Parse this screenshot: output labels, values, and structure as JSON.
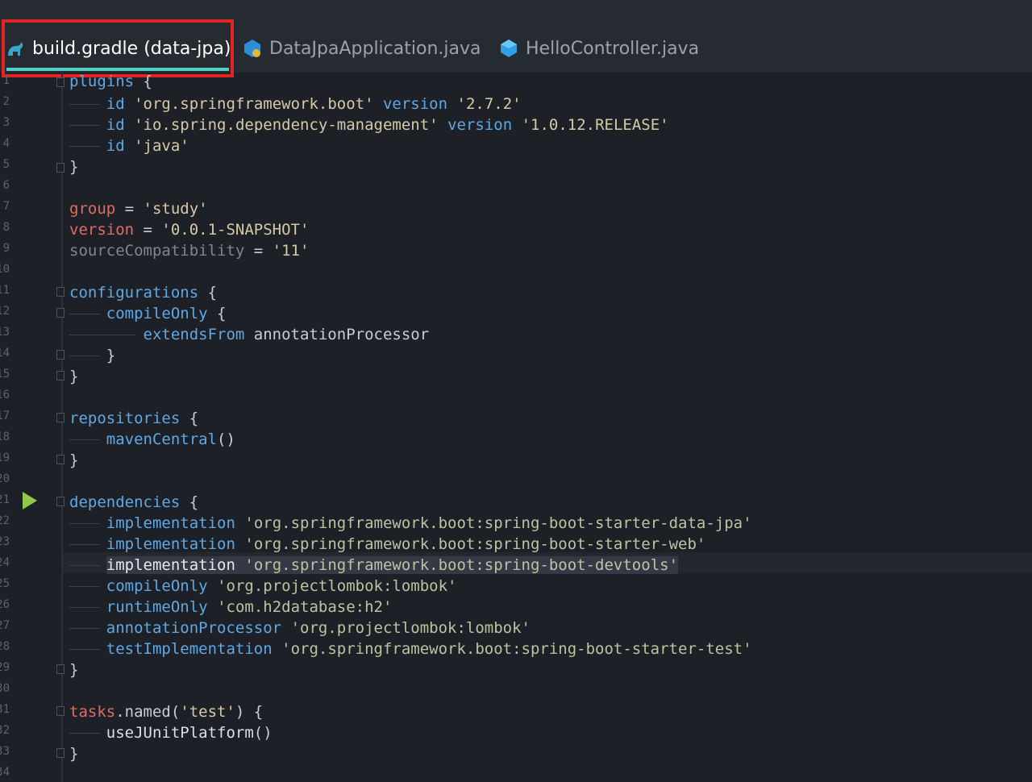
{
  "tabs": [
    {
      "label": "build.gradle (data-jpa)",
      "icon": "gradle-icon",
      "active": true
    },
    {
      "label": "DataJpaApplication.java",
      "icon": "java-class-run-icon",
      "active": false
    },
    {
      "label": "HelloController.java",
      "icon": "java-class-icon",
      "active": false
    }
  ],
  "line_numbers": [
    "1",
    "2",
    "3",
    "4",
    "5",
    "6",
    "7",
    "8",
    "9",
    "10",
    "11",
    "12",
    "13",
    "14",
    "15",
    "16",
    "17",
    "18",
    "19",
    "20",
    "21",
    "22",
    "23",
    "24",
    "25",
    "26",
    "27",
    "28",
    "29",
    "30",
    "31",
    "32",
    "33",
    "34"
  ],
  "code": {
    "l1": {
      "kw": "plugins",
      "rest": " {"
    },
    "l2": {
      "kw": "id",
      "str": "'org.springframework.boot'",
      "kw2": "version",
      "str2": "'2.7.2'"
    },
    "l3": {
      "kw": "id",
      "str": "'io.spring.dependency-management'",
      "kw2": "version",
      "str2": "'1.0.12.RELEASE'"
    },
    "l4": {
      "kw": "id",
      "str": "'java'"
    },
    "l5": "}",
    "l7": {
      "kw": "group",
      "op": " = ",
      "str": "'study'"
    },
    "l8": {
      "kw": "version",
      "op": " = ",
      "str": "'0.0.1-SNAPSHOT'"
    },
    "l9": {
      "kw": "sourceCompatibility",
      "op": " = ",
      "str": "'11'"
    },
    "l11": {
      "kw": "configurations",
      "rest": " {"
    },
    "l12": {
      "kw": "compileOnly",
      "rest": " {"
    },
    "l13": {
      "kw": "extendsFrom",
      "rest": " annotationProcessor"
    },
    "l14": "}",
    "l15": "}",
    "l17": {
      "kw": "repositories",
      "rest": " {"
    },
    "l18": {
      "kw": "mavenCentral",
      "rest": "()"
    },
    "l19": "}",
    "l21": {
      "kw": "dependencies",
      "rest": " {"
    },
    "l22": {
      "kw": "implementation",
      "str": "'org.springframework.boot:spring-boot-starter-data-jpa'"
    },
    "l23": {
      "kw": "implementation",
      "str": "'org.springframework.boot:spring-boot-starter-web'"
    },
    "l24": {
      "kw": "implementation",
      "str": "'org.springframework.boot:spring-boot-devtools'"
    },
    "l25": {
      "kw": "compileOnly",
      "str": "'org.projectlombok:lombok'"
    },
    "l26": {
      "kw": "runtimeOnly",
      "str": "'com.h2database:h2'"
    },
    "l27": {
      "kw": "annotationProcessor",
      "str": "'org.projectlombok:lombok'"
    },
    "l28": {
      "kw": "testImplementation",
      "str": "'org.springframework.boot:spring-boot-starter-test'"
    },
    "l29": "}",
    "l31": {
      "kw": "tasks",
      "rest": ".named(",
      "str": "'test'",
      "rest2": ") {"
    },
    "l32": {
      "kw": "useJUnitPlatform",
      "rest": "()"
    },
    "l33": "}"
  },
  "colors": {
    "accent": "#4ecfc4",
    "highlight": "#e32424",
    "run": "#94c84a"
  }
}
